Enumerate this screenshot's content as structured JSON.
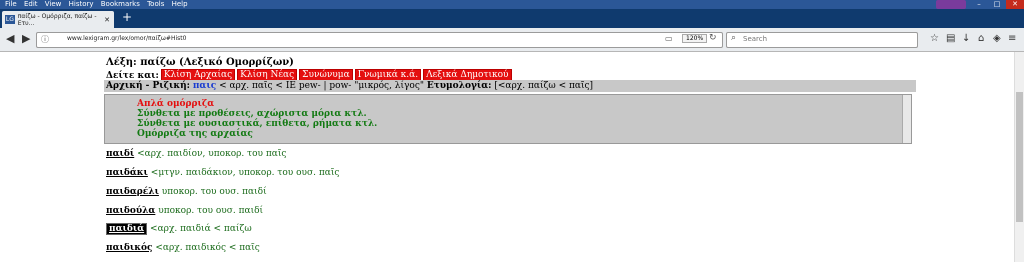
{
  "browser": {
    "menu": [
      "File",
      "Edit",
      "View",
      "History",
      "Bookmarks",
      "Tools",
      "Help"
    ],
    "tab_title": "παίζω - Ομόρριζα, παίζω - Ετυ...",
    "tab_favicon": "LG",
    "url": "www.lexigram.gr/lex/omor/παίζω#Hist0",
    "zoom": "120%",
    "search_placeholder": "Search"
  },
  "page": {
    "lemma_title": "Λέξη: παίζω (Λεξικό Ομορρίζων)",
    "see_also_label": "Δείτε και:",
    "see_also": [
      "Κλίση Αρχαίας",
      "Κλίση Νέας",
      "Συνώνυμα",
      "Γνωμικά κ.ά.",
      "Λεξικά Δημοτικού"
    ],
    "root_label": "Αρχική - Ριζική:",
    "root_word": "παις",
    "root_text": "< αρχ. παῖς < IE pew- | pow- \"μικρός, λίγος\"",
    "etym_label": "Ετυμολογία:",
    "etym_text": "[<αρχ. παίζω < παῖς]",
    "categories": [
      {
        "label": "Απλά ομόρριζα",
        "color": "#e40f0f"
      },
      {
        "label": "Σύνθετα με προθέσεις, αχώριστα μόρια κτλ.",
        "color": "#137a13"
      },
      {
        "label": "Σύνθετα με ουσιαστικά, επίθετα, ρήματα κτλ.",
        "color": "#137a13"
      },
      {
        "label": "Ομόρριζα της αρχαίας",
        "color": "#137a13"
      }
    ],
    "entries": [
      {
        "word": "παιδί",
        "desc": "<αρχ. παιδίον, υποκορ. του παῖς"
      },
      {
        "word": "παιδάκι",
        "desc": "<μτγν. παιδάκιον, υποκορ. του ουσ. παῖς"
      },
      {
        "word": "παιδαρέλι",
        "desc": "υποκορ. του ουσ. παιδί"
      },
      {
        "word": "παιδούλα",
        "desc": "υποκορ. του ουσ. παιδί"
      },
      {
        "word": "παιδιά",
        "desc": "<αρχ. παιδιά < παίζω"
      },
      {
        "word": "παιδικός",
        "desc": "<αρχ. παιδικός < παῖς"
      }
    ]
  }
}
